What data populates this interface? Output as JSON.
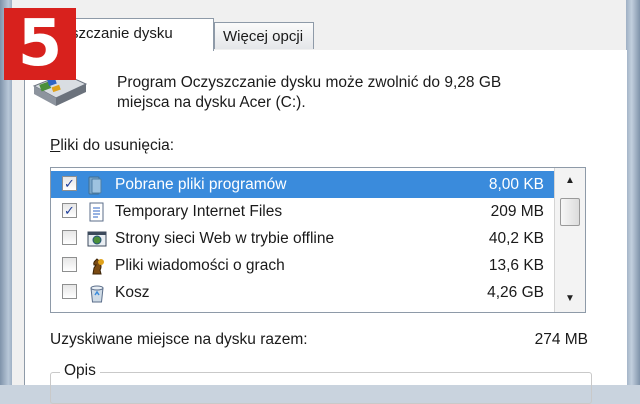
{
  "badge": {
    "number": "5",
    "color": "#d8211d"
  },
  "tabs": {
    "active_label": "szczanie dysku",
    "more_label": "Więcej opcji"
  },
  "intro": {
    "line1": "Program Oczyszczanie dysku może zwolnić do 9,28 GB",
    "line2": "miejsca na dysku Acer (C:)."
  },
  "files_label_prefix": "P",
  "files_label_rest": "liki do usunięcia:",
  "files": [
    {
      "name": "Pobrane pliki programów",
      "size": "8,00 KB",
      "checked": true,
      "icon": "folder-icon",
      "selected": true
    },
    {
      "name": "Temporary Internet Files",
      "size": "209 MB",
      "checked": true,
      "icon": "document-icon",
      "selected": false
    },
    {
      "name": "Strony sieci Web w trybie offline",
      "size": "40,2 KB",
      "checked": false,
      "icon": "web-page-icon",
      "selected": false
    },
    {
      "name": "Pliki wiadomości o grach",
      "size": "13,6 KB",
      "checked": false,
      "icon": "chess-piece-icon",
      "selected": false
    },
    {
      "name": "Kosz",
      "size": "4,26 GB",
      "checked": false,
      "icon": "recycle-bin-icon",
      "selected": false
    }
  ],
  "total": {
    "label": "Uzyskiwane miejsce na dysku razem:",
    "value": "274 MB"
  },
  "description_group": {
    "legend": "Opis"
  },
  "colors": {
    "selection": "#3a8bdc",
    "window_frame": "#9fb0c4"
  }
}
